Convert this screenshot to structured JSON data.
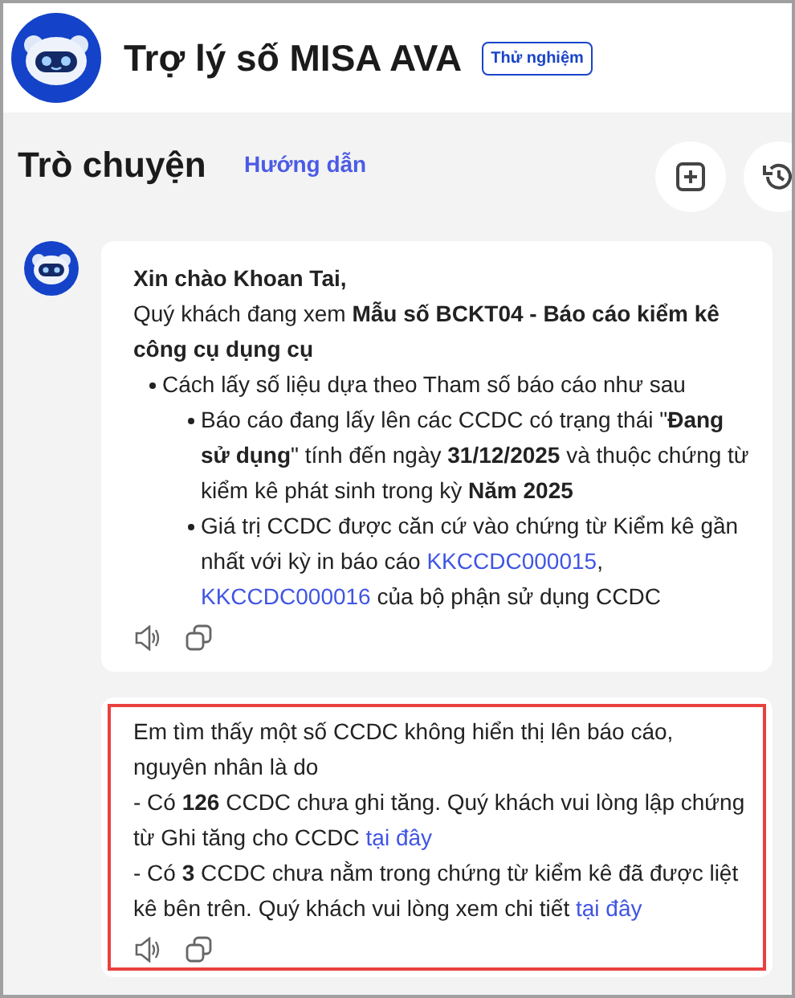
{
  "header": {
    "title": "Trợ lý số MISA AVA",
    "badge": "Thử nghiệm"
  },
  "chat_bar": {
    "title": "Trò chuyện",
    "guide_link": "Hướng dẫn"
  },
  "messages": [
    {
      "highlighted": false,
      "blocks": [
        {
          "kind": "greeting",
          "parts": [
            {
              "kind": "text",
              "text": "Xin chào Khoan Tai,"
            }
          ]
        },
        {
          "kind": "paragraph",
          "parts": [
            {
              "kind": "text",
              "text": "Quý khách đang xem **Mẫu số BCKT04 - Báo cáo kiểm kê công cụ dụng cụ**"
            }
          ]
        },
        {
          "kind": "bullet",
          "parts": [
            {
              "kind": "text",
              "text": "Cách lấy số liệu dựa theo Tham số báo cáo như sau"
            }
          ],
          "children": [
            {
              "kind": "bullet",
              "parts": [
                {
                  "kind": "text",
                  "text": "Báo cáo đang lấy lên các CCDC có trạng thái \"**Đang sử dụng**\" tính đến ngày **31/12/2025** và thuộc chứng từ kiểm kê phát sinh trong kỳ **Năm 2025**"
                }
              ]
            },
            {
              "kind": "bullet",
              "parts": [
                {
                  "kind": "text",
                  "text": "Giá trị CCDC được căn cứ vào chứng từ Kiểm kê gần nhất với kỳ in báo cáo "
                },
                {
                  "kind": "link",
                  "text": "KKCCDC000015"
                },
                {
                  "kind": "text",
                  "text": ", "
                },
                {
                  "kind": "link",
                  "text": "KKCCDC000016"
                },
                {
                  "kind": "text",
                  "text": " của bộ phận sử dụng CCDC"
                }
              ]
            }
          ]
        }
      ]
    },
    {
      "highlighted": true,
      "blocks": [
        {
          "kind": "paragraph",
          "parts": [
            {
              "kind": "text",
              "text": "Em tìm thấy một số CCDC không hiển thị lên báo cáo, nguyên nhân là do"
            }
          ]
        },
        {
          "kind": "paragraph",
          "parts": [
            {
              "kind": "text",
              "text": "- Có **126** CCDC chưa ghi tăng. Quý khách vui lòng lập chứng từ Ghi tăng cho CCDC "
            },
            {
              "kind": "link",
              "text": "tại đây"
            }
          ]
        },
        {
          "kind": "paragraph",
          "parts": [
            {
              "kind": "text",
              "text": "- Có **3** CCDC chưa nằm trong chứng từ kiểm kê đã được liệt kê bên trên. Quý khách vui lòng xem chi tiết "
            },
            {
              "kind": "link",
              "text": "tại đây"
            }
          ]
        }
      ]
    }
  ]
}
